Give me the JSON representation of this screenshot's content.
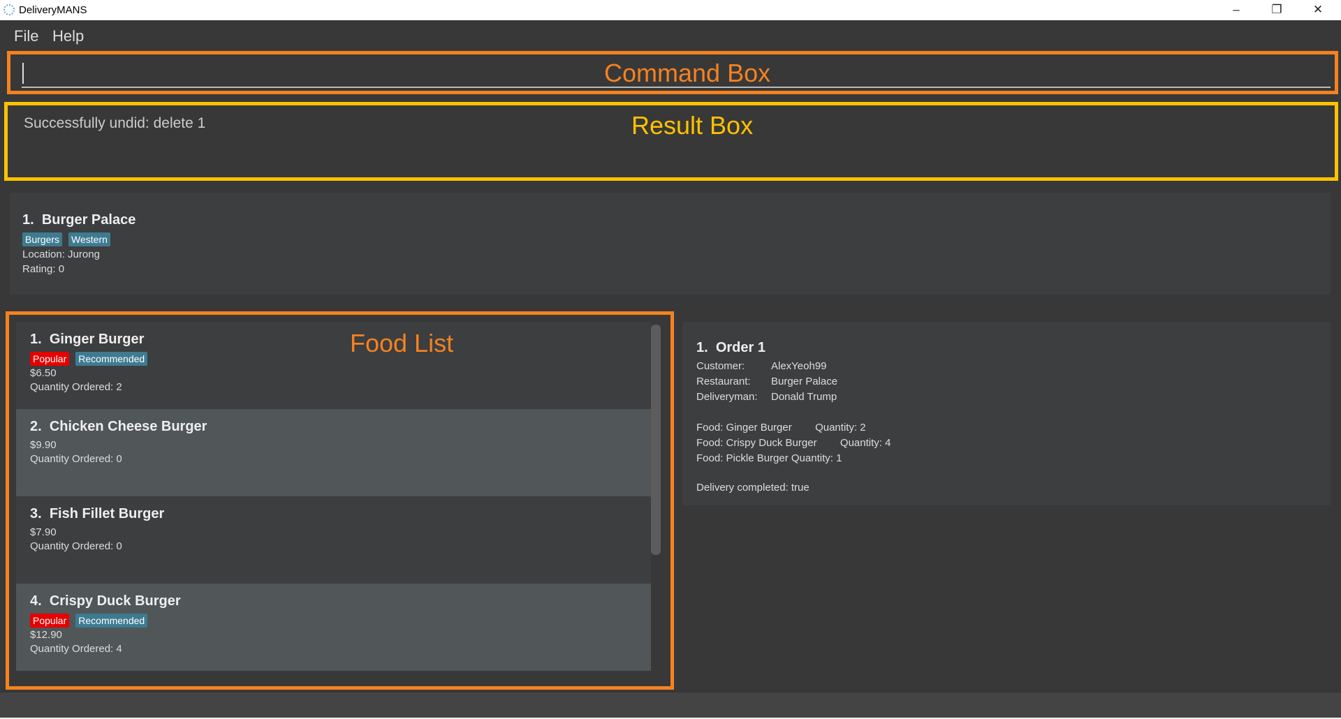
{
  "window": {
    "title": "DeliveryMANS",
    "minimize": "–",
    "maximize": "❐",
    "close": "✕"
  },
  "menu": [
    "File",
    "Help"
  ],
  "command_box": {
    "value": "",
    "label": "Command Box"
  },
  "result_box": {
    "message": "Successfully undid: delete 1",
    "label": "Result Box"
  },
  "restaurant": {
    "index": "1.",
    "name": "Burger Palace",
    "tags": [
      "Burgers",
      "Western"
    ],
    "location": "Location: Jurong",
    "rating": "Rating: 0"
  },
  "food_list": {
    "label": "Food List",
    "items": [
      {
        "index": "1.",
        "name": "Ginger Burger",
        "tags": [
          {
            "text": "Popular",
            "color": "#e60000"
          },
          {
            "text": "Recommended",
            "color": "#3e7b91"
          }
        ],
        "price": "$6.50",
        "quantity": "Quantity Ordered: 2"
      },
      {
        "index": "2.",
        "name": "Chicken Cheese Burger",
        "tags": [],
        "price": "$9.90",
        "quantity": "Quantity Ordered: 0"
      },
      {
        "index": "3.",
        "name": "Fish Fillet Burger",
        "tags": [],
        "price": "$7.90",
        "quantity": "Quantity Ordered: 0"
      },
      {
        "index": "4.",
        "name": "Crispy Duck Burger",
        "tags": [
          {
            "text": "Popular",
            "color": "#e60000"
          },
          {
            "text": "Recommended",
            "color": "#3e7b91"
          }
        ],
        "price": "$12.90",
        "quantity": "Quantity Ordered: 4"
      }
    ]
  },
  "order": {
    "index": "1.",
    "title": "Order 1",
    "customer_label": "Customer:",
    "customer": "AlexYeoh99",
    "restaurant_label": "Restaurant:",
    "restaurant": "Burger Palace",
    "deliveryman_label": "Deliveryman:",
    "deliveryman": "Donald Trump",
    "foods": [
      "Food: Ginger Burger        Quantity: 2",
      "Food: Crispy Duck Burger        Quantity: 4",
      "Food: Pickle Burger Quantity: 1"
    ],
    "completed": "Delivery completed: true"
  },
  "colors": {
    "command_border": "#f5821f",
    "result_border": "#ffc200",
    "tag_blue": "#3e7b91",
    "tag_red": "#e60000"
  }
}
